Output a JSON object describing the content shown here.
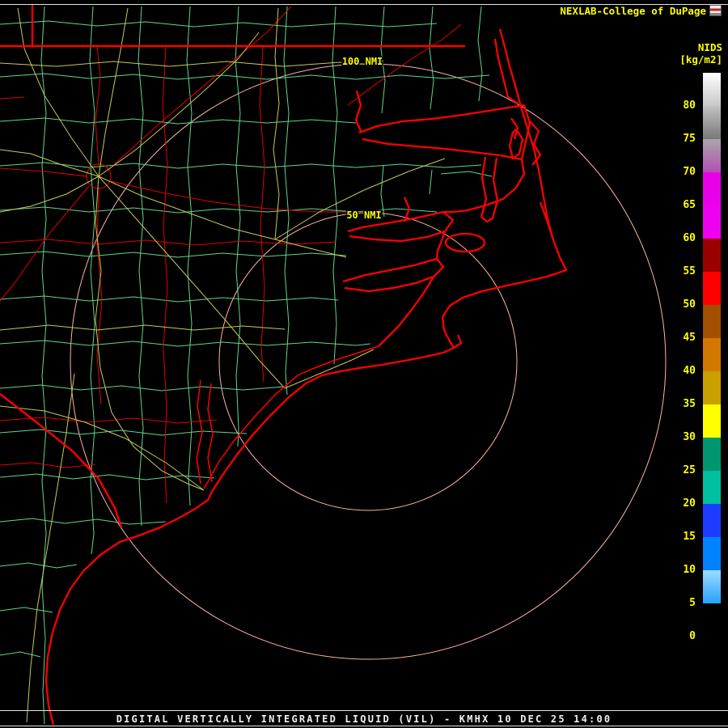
{
  "header": {
    "brand": "NEXLAB-College of DuPage"
  },
  "colorbar": {
    "title": "NIDS",
    "units": "[kg/m2]",
    "tick_labels": [
      "80",
      "75",
      "70",
      "65",
      "60",
      "55",
      "50",
      "45",
      "40",
      "35",
      "30",
      "25",
      "20",
      "15",
      "10",
      "5",
      "0"
    ],
    "segments": [
      {
        "range": ">80",
        "color": "#ffffff",
        "color2": "#c8c8c8"
      },
      {
        "range": "75-80",
        "color": "#c2c2c2",
        "color2": "#787878"
      },
      {
        "range": "70-75",
        "color": "#a8a8a8",
        "color2": "#b44eb4"
      },
      {
        "range": "65-70",
        "color": "#e800e8"
      },
      {
        "range": "60-65",
        "color": "#f000f0"
      },
      {
        "range": "55-60",
        "color": "#9a0000"
      },
      {
        "range": "50-55",
        "color": "#ff0000"
      },
      {
        "range": "45-50",
        "color": "#a05000"
      },
      {
        "range": "40-45",
        "color": "#d27800"
      },
      {
        "range": "35-40",
        "color": "#c8a000"
      },
      {
        "range": "30-35",
        "color": "#ffff00"
      },
      {
        "range": "25-30",
        "color": "#009670"
      },
      {
        "range": "20-25",
        "color": "#00bfa0"
      },
      {
        "range": "15-20",
        "color": "#1e3cff"
      },
      {
        "range": "10-15",
        "color": "#0082ff"
      },
      {
        "range": "5-10",
        "color": "#9cdcff",
        "color2": "#28a0ff"
      },
      {
        "range": "0-5",
        "color": "#000000"
      }
    ]
  },
  "map": {
    "ring_labels": {
      "outer": "100 NMI",
      "inner": "50 NMI"
    },
    "radar_site": "KMHX"
  },
  "footer": {
    "title": "DIGITAL VERTICALLY INTEGRATED LIQUID (VIL) - KMHX 10 DEC 25 14:00"
  },
  "colors": {
    "background": "#000000",
    "coastline": "#ff0000",
    "thin_red": "#e60000",
    "county": "#5fd78f",
    "road": "#c9c955",
    "ring": "#ffb3a7",
    "label_yellow": "#ffff00",
    "separator": "#e6e6e6",
    "footer_text": "#f0f0f0"
  }
}
